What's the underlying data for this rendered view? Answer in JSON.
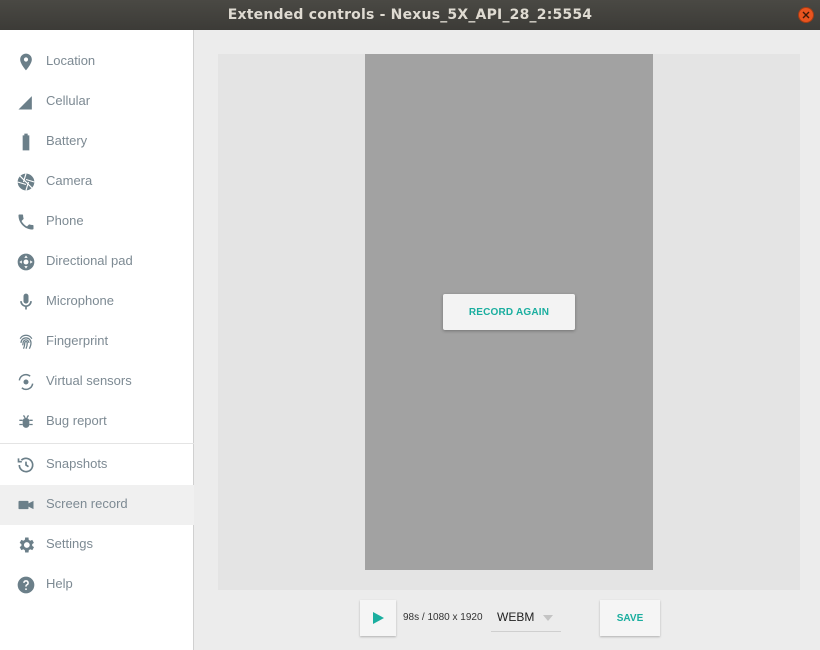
{
  "window": {
    "title": "Extended controls - Nexus_5X_API_28_2:5554"
  },
  "colors": {
    "accent": "#1aae9f",
    "icon": "#6b7f89",
    "close": "#e9541f"
  },
  "sidebar": {
    "items": [
      {
        "label": "Location",
        "icon": "location-pin-icon"
      },
      {
        "label": "Cellular",
        "icon": "cellular-signal-icon"
      },
      {
        "label": "Battery",
        "icon": "battery-icon"
      },
      {
        "label": "Camera",
        "icon": "camera-aperture-icon"
      },
      {
        "label": "Phone",
        "icon": "phone-icon"
      },
      {
        "label": "Directional pad",
        "icon": "dpad-icon"
      },
      {
        "label": "Microphone",
        "icon": "microphone-icon"
      },
      {
        "label": "Fingerprint",
        "icon": "fingerprint-icon"
      },
      {
        "label": "Virtual sensors",
        "icon": "rotation-icon"
      },
      {
        "label": "Bug report",
        "icon": "bug-icon"
      },
      {
        "label": "Snapshots",
        "icon": "history-icon"
      },
      {
        "label": "Screen record",
        "icon": "videocam-icon",
        "active": true
      },
      {
        "label": "Settings",
        "icon": "gear-icon"
      },
      {
        "label": "Help",
        "icon": "help-icon"
      }
    ]
  },
  "screen_record": {
    "record_again_label": "RECORD AGAIN",
    "info": "98s / 1080 x 1920",
    "format": "WEBM",
    "save_label": "SAVE"
  }
}
